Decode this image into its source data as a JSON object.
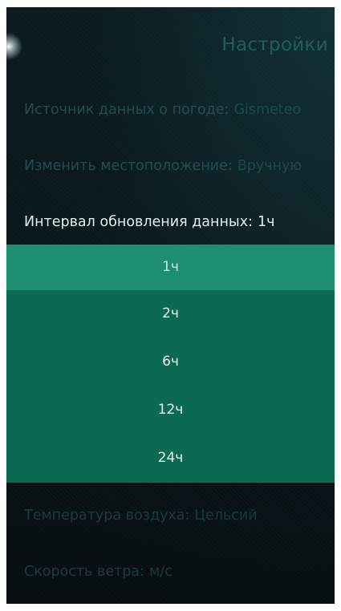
{
  "header": {
    "title": "Настройки"
  },
  "settings": {
    "source": {
      "label": "Источник данных о погоде:",
      "value": "Gismeteo"
    },
    "location": {
      "label": "Изменить местоположение:",
      "value": "Вручную"
    },
    "interval": {
      "label": "Интервал обновления данных:",
      "value": "1ч"
    },
    "temperature": {
      "label": "Температура воздуха:",
      "value": "Цельсий"
    },
    "wind": {
      "label": "Скорость ветра:",
      "value": "м/с"
    }
  },
  "dropdown": {
    "options": [
      "1ч",
      "2ч",
      "6ч",
      "12ч",
      "24ч"
    ],
    "selected": "1ч"
  },
  "colors": {
    "accent": "#0c6a53",
    "highlight": "#1d8e70",
    "background": "#0a1a1e"
  }
}
